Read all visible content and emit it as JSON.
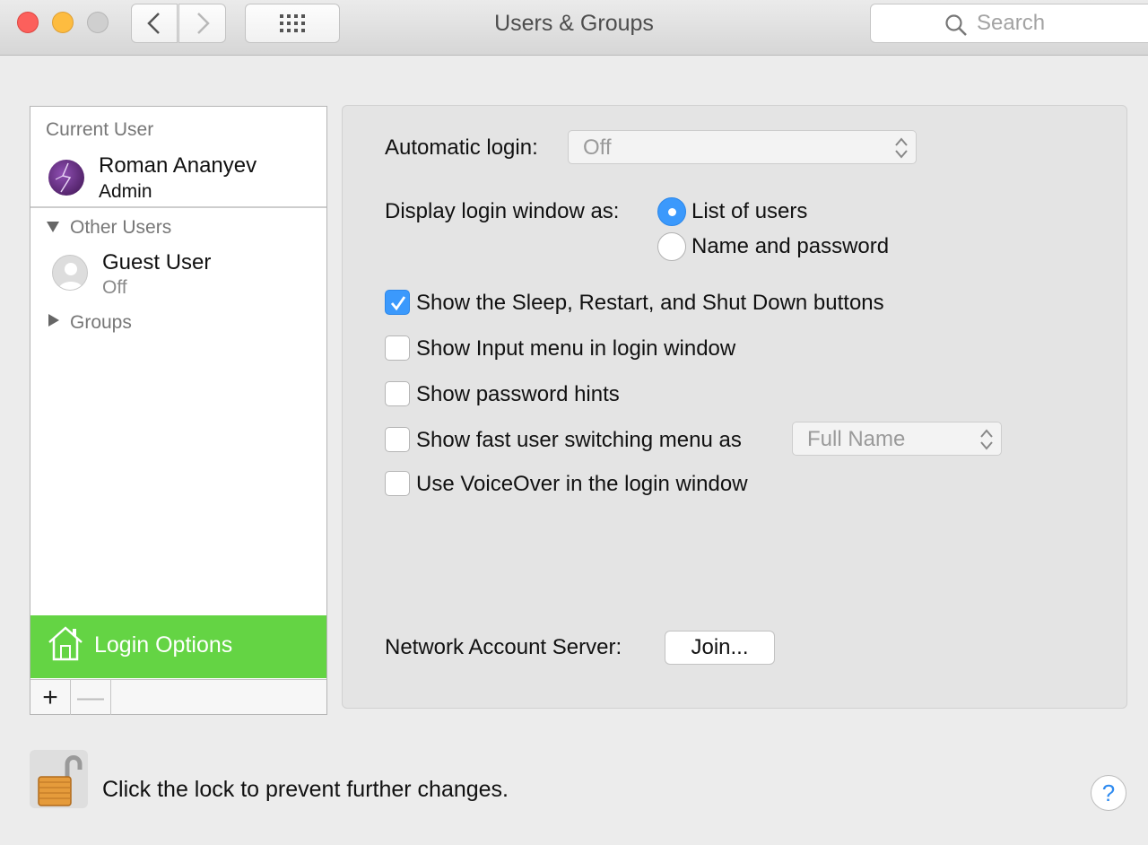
{
  "window": {
    "title": "Users & Groups",
    "search_placeholder": "Search"
  },
  "sidebar": {
    "current_user_label": "Current User",
    "current_user": {
      "name": "Roman Ananyev",
      "role": "Admin"
    },
    "other_users_label": "Other Users",
    "guest_user": {
      "name": "Guest User",
      "status": "Off"
    },
    "groups_label": "Groups",
    "login_options_label": "Login Options",
    "add_label": "+",
    "remove_label": "—"
  },
  "main": {
    "automatic_login_label": "Automatic login:",
    "automatic_login_value": "Off",
    "display_login_label": "Display login window as:",
    "radio_options": [
      {
        "label": "List of users",
        "selected": true
      },
      {
        "label": "Name and password",
        "selected": false
      }
    ],
    "checkboxes": [
      {
        "label": "Show the Sleep, Restart, and Shut Down buttons",
        "checked": true
      },
      {
        "label": "Show Input menu in login window",
        "checked": false
      },
      {
        "label": "Show password hints",
        "checked": false
      },
      {
        "label": "Show fast user switching menu as",
        "checked": false
      },
      {
        "label": "Use VoiceOver in the login window",
        "checked": false
      }
    ],
    "fast_switch_value": "Full Name",
    "network_server_label": "Network Account Server:",
    "join_label": "Join..."
  },
  "footer": {
    "lock_text": "Click the lock to prevent further changes.",
    "help_label": "?"
  },
  "colors": {
    "accent": "#3b99fc",
    "login_options_bg": "#64d444",
    "close": "#fc605c",
    "minimize": "#fdbc40"
  }
}
